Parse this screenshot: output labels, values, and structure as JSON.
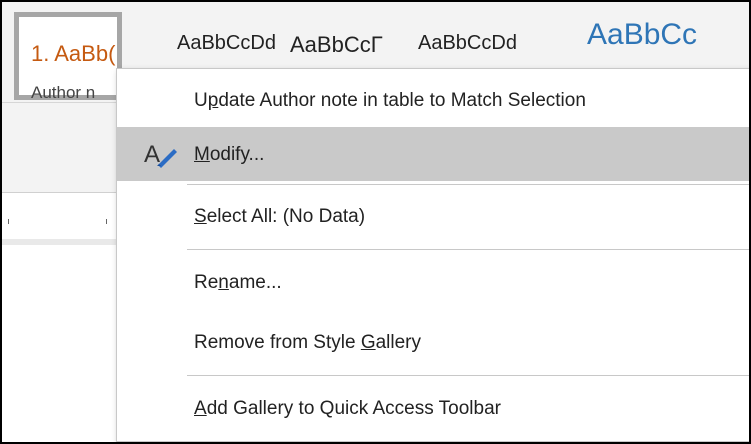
{
  "gallery": {
    "selected_style": {
      "preview": "1. AaBb(",
      "name": "Author n"
    },
    "previews": [
      "AaBbCcDd",
      "AaBbCcΓ",
      "AaBbCcDd",
      "AaBbCc"
    ]
  },
  "menu": {
    "items": [
      {
        "pre": "U",
        "key": "p",
        "post": "date Author note in table to Match Selection"
      },
      {
        "pre": "",
        "key": "M",
        "post": "odify..."
      },
      {
        "pre": "",
        "key": "S",
        "post": "elect All: (No Data)"
      },
      {
        "pre": "Re",
        "key": "n",
        "post": "ame..."
      },
      {
        "pre": "Remove from Style ",
        "key": "G",
        "post": "allery"
      },
      {
        "pre": "",
        "key": "A",
        "post": "dd Gallery to Quick Access Toolbar"
      }
    ],
    "modify_icon": "modify-style-icon",
    "highlight_color": "#c9c9c9"
  },
  "colors": {
    "accent_orange": "#c55a11",
    "heading_blue": "#2e75b6",
    "icon_blue": "#2b6cc4"
  }
}
